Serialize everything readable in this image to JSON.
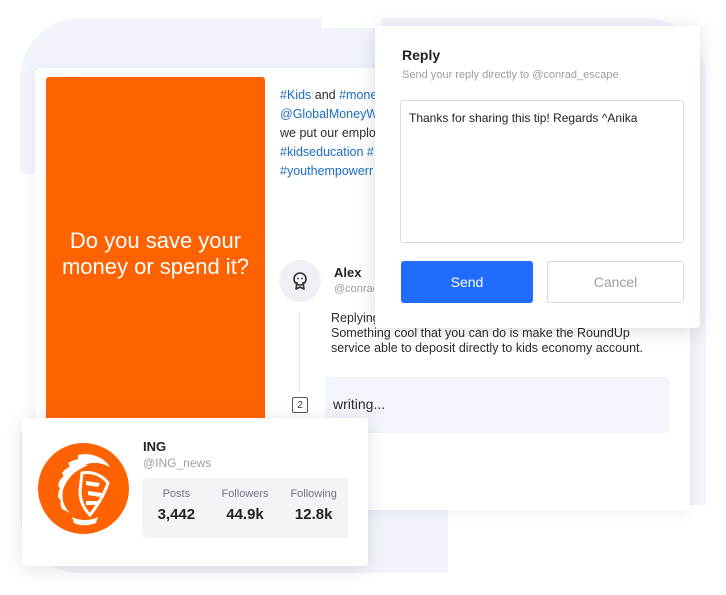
{
  "post": {
    "promo_text": "Do you save your money or spend it?",
    "tweet_lines": [
      [
        {
          "t": "#Kids",
          "tag": true
        },
        {
          "t": " and ",
          "tag": false
        },
        {
          "t": "#mone",
          "tag": true
        }
      ],
      [
        {
          "t": "@GlobalMoneyW",
          "tag": true
        }
      ],
      [
        {
          "t": " we put our emplo",
          "tag": false
        }
      ],
      [
        {
          "t": "#kidseducation",
          "tag": true
        },
        {
          "t": " ",
          "tag": false
        },
        {
          "t": "#",
          "tag": true
        }
      ],
      [
        {
          "t": "#youthempowerr",
          "tag": true
        }
      ]
    ],
    "reply": {
      "name": "Alex",
      "handle": "@conrad",
      "replying_to": "Replying",
      "body": "Something cool that you can do is make the RoundUp service able to deposit directly to kids economy account.",
      "count": "2"
    },
    "writing_placeholder": "writing..."
  },
  "reply_panel": {
    "title": "Reply",
    "subtitle": "Send your reply directly to @conrad_escape",
    "message": "Thanks for sharing this tip! Regards ^Anika",
    "send_label": "Send",
    "cancel_label": "Cancel"
  },
  "profile": {
    "name": "ING",
    "handle": "@ING_news",
    "stats": [
      {
        "label": "Posts",
        "value": "3,442"
      },
      {
        "label": "Followers",
        "value": "44.9k"
      },
      {
        "label": "Following",
        "value": "12.8k"
      }
    ],
    "logo_icon": "ing-lion-logo-icon"
  },
  "colors": {
    "brand_orange": "#ff6200",
    "primary_blue": "#1f6cff",
    "hashtag_blue": "#1a6cc4"
  }
}
